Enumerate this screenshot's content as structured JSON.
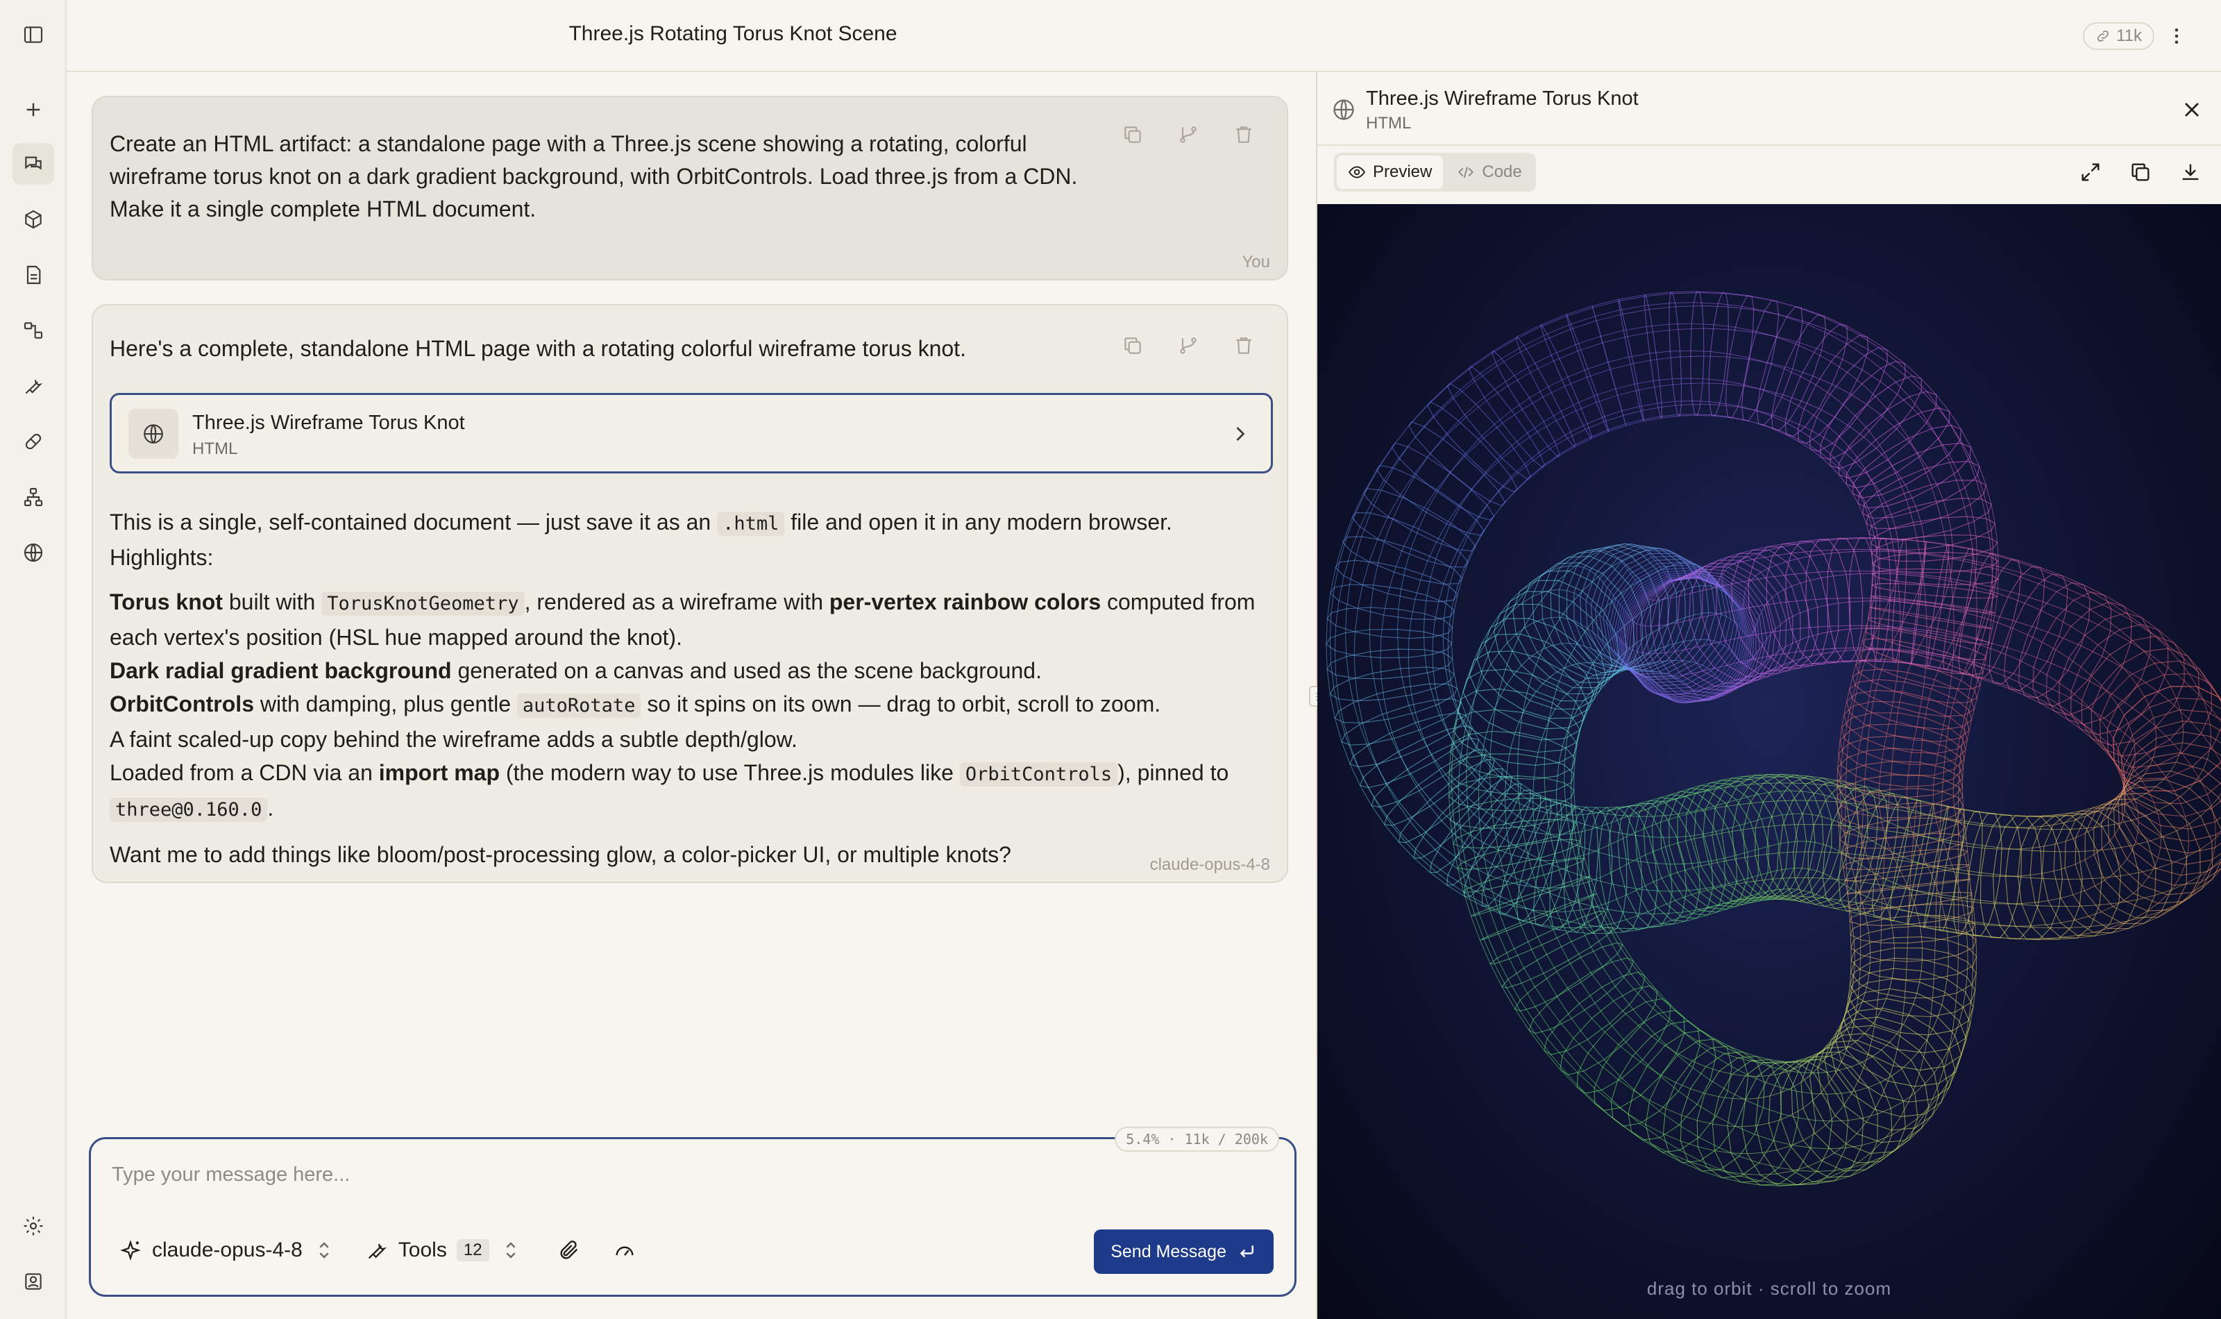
{
  "header": {
    "chat_title": "Three.js Rotating Torus Knot Scene",
    "token_count": "11k"
  },
  "rail": {
    "items": [
      "sidebar-toggle-icon",
      "new-chat-icon",
      "chats-icon",
      "cube-icon",
      "document-icon",
      "workflow-icon",
      "wrench-icon",
      "pill-icon",
      "hierarchy-icon",
      "globe-icon"
    ],
    "bottom": [
      "settings-icon",
      "user-icon"
    ]
  },
  "user_message": {
    "text": "Create an HTML artifact: a standalone page with a Three.js scene showing a rotating, colorful wireframe torus knot on a dark gradient background, with OrbitControls. Load three.js from a CDN. Make it a single complete HTML document.",
    "author": "You"
  },
  "assistant_message": {
    "intro": "Here's a complete, standalone HTML page with a rotating colorful wireframe torus knot.",
    "artifact": {
      "title": "Three.js Wireframe Torus Knot",
      "type": "HTML"
    },
    "p1_a": "This is a single, self-contained document — just save it as an ",
    "p1_code": ".html",
    "p1_b": " file and open it in any modern browser. Highlights:",
    "b1_bold": "Torus knot",
    "b1_a": " built with ",
    "b1_code": "TorusKnotGeometry",
    "b1_b": ", rendered as a wireframe with ",
    "b1_bold2": "per-vertex rainbow colors",
    "b1_c": " computed from each vertex's position (HSL hue mapped around the knot).",
    "b2_bold": "Dark radial gradient background",
    "b2_a": " generated on a canvas and used as the scene background.",
    "b3_bold": "OrbitControls",
    "b3_a": " with damping, plus gentle ",
    "b3_code": "autoRotate",
    "b3_b": " so it spins on its own — drag to orbit, scroll to zoom.",
    "b4": "A faint scaled-up copy behind the wireframe adds a subtle depth/glow.",
    "b5_a": "Loaded from a CDN via an ",
    "b5_bold": "import map",
    "b5_b": " (the modern way to use Three.js modules like ",
    "b5_code": "OrbitControls",
    "b5_c": "), pinned to",
    "b5_code2": "three@0.160.0",
    "b5_d": ".",
    "closing": "Want me to add things like bloom/post-processing glow, a color-picker UI, or multiple knots?",
    "model": "claude-opus-4-8"
  },
  "composer": {
    "placeholder": "Type your message here...",
    "context_usage": "5.4% · 11k / 200k",
    "model": "claude-opus-4-8",
    "tools_label": "Tools",
    "tools_count": "12",
    "send_label": "Send Message"
  },
  "panel": {
    "title": "Three.js Wireframe Torus Knot",
    "type": "HTML",
    "tab_preview": "Preview",
    "tab_code": "Code",
    "hint": "drag to orbit · scroll to zoom"
  }
}
